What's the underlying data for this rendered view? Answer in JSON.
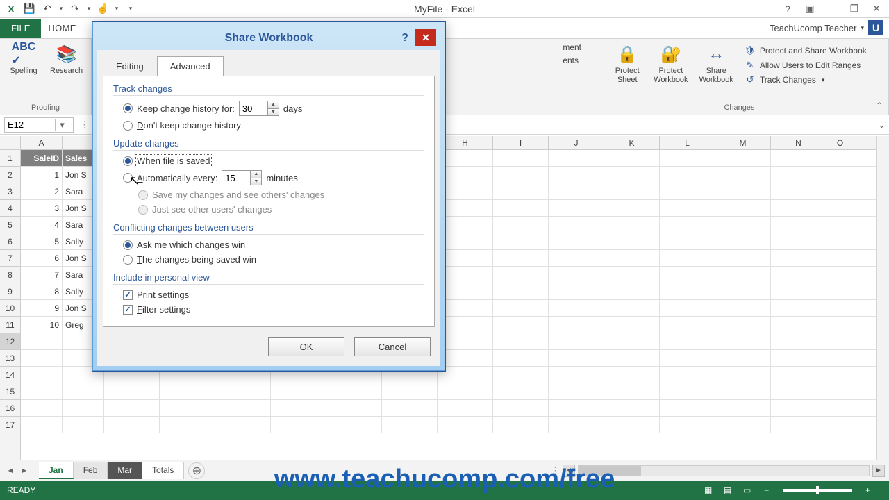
{
  "app": {
    "title": "MyFile - Excel"
  },
  "qat": {
    "excel": "⊞",
    "save": "💾",
    "undo": "↶",
    "redo": "↷",
    "touch": "☝",
    "more": "▾"
  },
  "win": {
    "help": "?",
    "full": "▣",
    "min": "—",
    "restore": "❐",
    "close": "✕"
  },
  "ribbon": {
    "file": "FILE",
    "tabs": [
      "HOME"
    ],
    "signin": "TeachUcomp Teacher",
    "signin_arrow": "▾",
    "badge": "U",
    "groups": {
      "proofing": {
        "label": "Proofing",
        "spelling": "Spelling",
        "research": "Research"
      },
      "comments_partial": {
        "ment": "ment",
        "ents": "ents"
      },
      "changes": {
        "label": "Changes",
        "protect_sheet": "Protect\nSheet",
        "protect_wb": "Protect\nWorkbook",
        "share_wb": "Share\nWorkbook",
        "protect_share": "Protect and Share Workbook",
        "allow_edit": "Allow Users to Edit Ranges",
        "track_changes": "Track Changes"
      }
    },
    "collapse": "⌃"
  },
  "namebox": {
    "value": "E12",
    "dd": "▾",
    "expand": "⌄"
  },
  "columns": [
    "A",
    "",
    "",
    "",
    "",
    "",
    "",
    "H",
    "I",
    "J",
    "K",
    "L",
    "M",
    "N",
    "O"
  ],
  "rows_nums": [
    "1",
    "2",
    "3",
    "4",
    "5",
    "6",
    "7",
    "8",
    "9",
    "10",
    "11",
    "12",
    "13",
    "14",
    "15",
    "16",
    "17"
  ],
  "data_headers": [
    "SaleID",
    "Sales"
  ],
  "data_rows": [
    [
      "1",
      "Jon S"
    ],
    [
      "2",
      "Sara"
    ],
    [
      "3",
      "Jon S"
    ],
    [
      "4",
      "Sara"
    ],
    [
      "5",
      "Sally"
    ],
    [
      "6",
      "Jon S"
    ],
    [
      "7",
      "Sara"
    ],
    [
      "8",
      "Sally"
    ],
    [
      "9",
      "Jon S"
    ],
    [
      "10",
      "Greg"
    ]
  ],
  "sheets": {
    "items": [
      "Jan",
      "Feb",
      "Mar",
      "Totals"
    ],
    "active": 0,
    "nav_prev": "◄",
    "nav_next": "►",
    "new": "⊕"
  },
  "status": {
    "ready": "READY",
    "zoom": "100%",
    "minus": "−",
    "plus": "+"
  },
  "dialog": {
    "title": "Share Workbook",
    "help": "?",
    "close": "✕",
    "tabs": {
      "editing": "Editing",
      "advanced": "Advanced"
    },
    "track": {
      "title": "Track changes",
      "keep": "Keep change history for:",
      "keep_val": "30",
      "days": "days",
      "dont": "Don't keep change history"
    },
    "update": {
      "title": "Update changes",
      "when_saved": "When file is saved",
      "auto": "Automatically every:",
      "auto_val": "15",
      "minutes": "minutes",
      "save_see": "Save my changes and see others' changes",
      "just_see": "Just see other users' changes"
    },
    "conflict": {
      "title": "Conflicting changes between users",
      "ask": "Ask me which changes win",
      "saved_win": "The changes being saved win"
    },
    "personal": {
      "title": "Include in personal view",
      "print": "Print settings",
      "filter": "Filter settings"
    },
    "ok": "OK",
    "cancel": "Cancel"
  },
  "watermark": "www.teachucomp.com/free"
}
